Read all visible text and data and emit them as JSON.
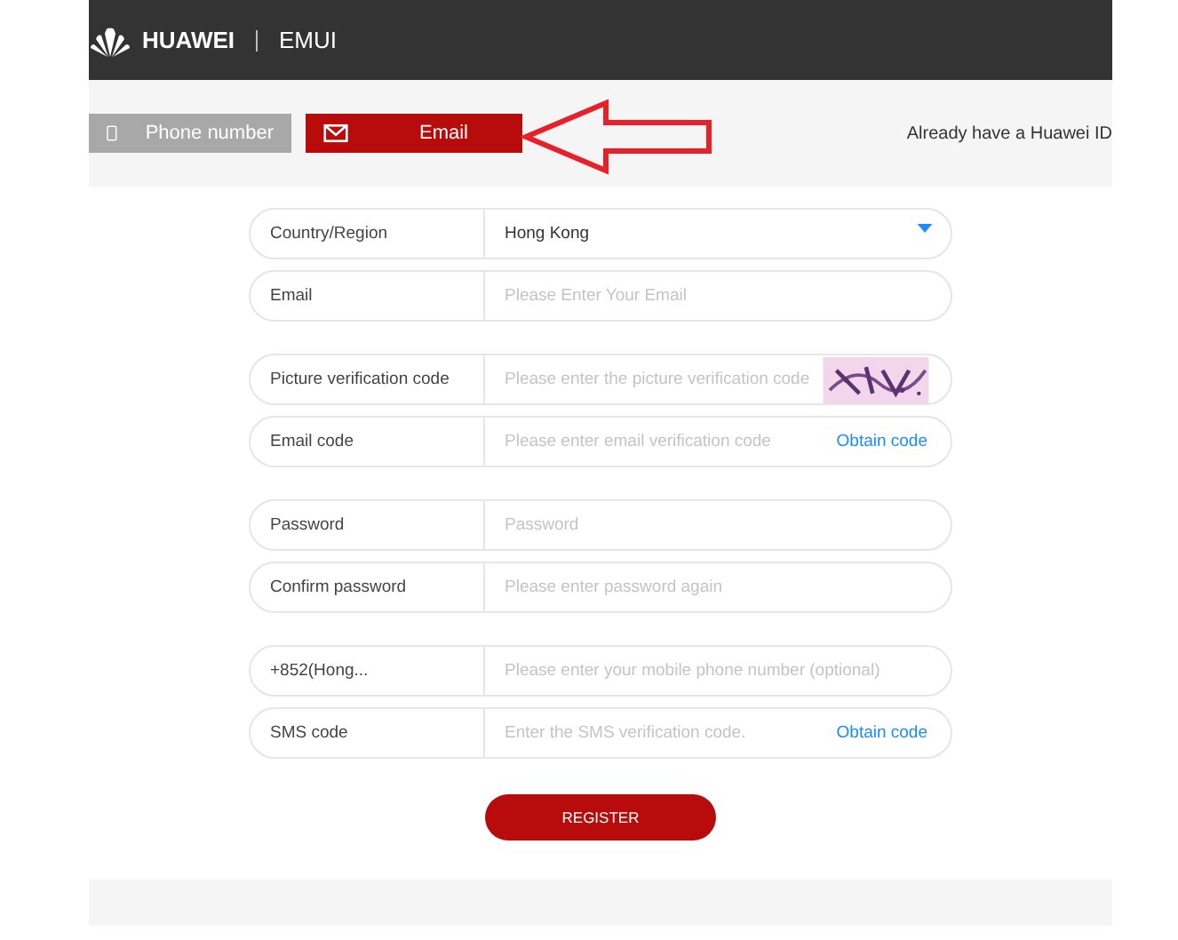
{
  "header": {
    "brand": "HUAWEI",
    "product": "EMUI"
  },
  "tabs": [
    {
      "label": "Phone number",
      "kind": "phone",
      "selected": false
    },
    {
      "label": "Email",
      "kind": "email",
      "selected": true
    }
  ],
  "login_prompt": "Already have a Huawei ID",
  "annotation": {
    "kind": "arrow"
  },
  "groups": [
    [
      {
        "kind": "select",
        "label": "Country/Region",
        "value": "Hong Kong"
      },
      {
        "kind": "input",
        "label": "Email",
        "placeholder": "Please Enter Your Email"
      }
    ],
    [
      {
        "kind": "captcha",
        "label": "Picture verification code",
        "placeholder": "Please enter the picture verification code"
      },
      {
        "kind": "code",
        "label": "Email code",
        "placeholder": "Please enter email verification code",
        "link": "Obtain code"
      }
    ],
    [
      {
        "kind": "input",
        "label": "Password",
        "placeholder": "Password"
      },
      {
        "kind": "input",
        "label": "Confirm password",
        "placeholder": "Please enter password again"
      }
    ],
    [
      {
        "kind": "input",
        "label": "+852(Hong...",
        "placeholder": "Please enter your mobile phone number (optional)"
      },
      {
        "kind": "code",
        "label": "SMS code",
        "placeholder": "Enter the SMS verification code.",
        "link": "Obtain code"
      }
    ]
  ],
  "register_button": "REGISTER"
}
